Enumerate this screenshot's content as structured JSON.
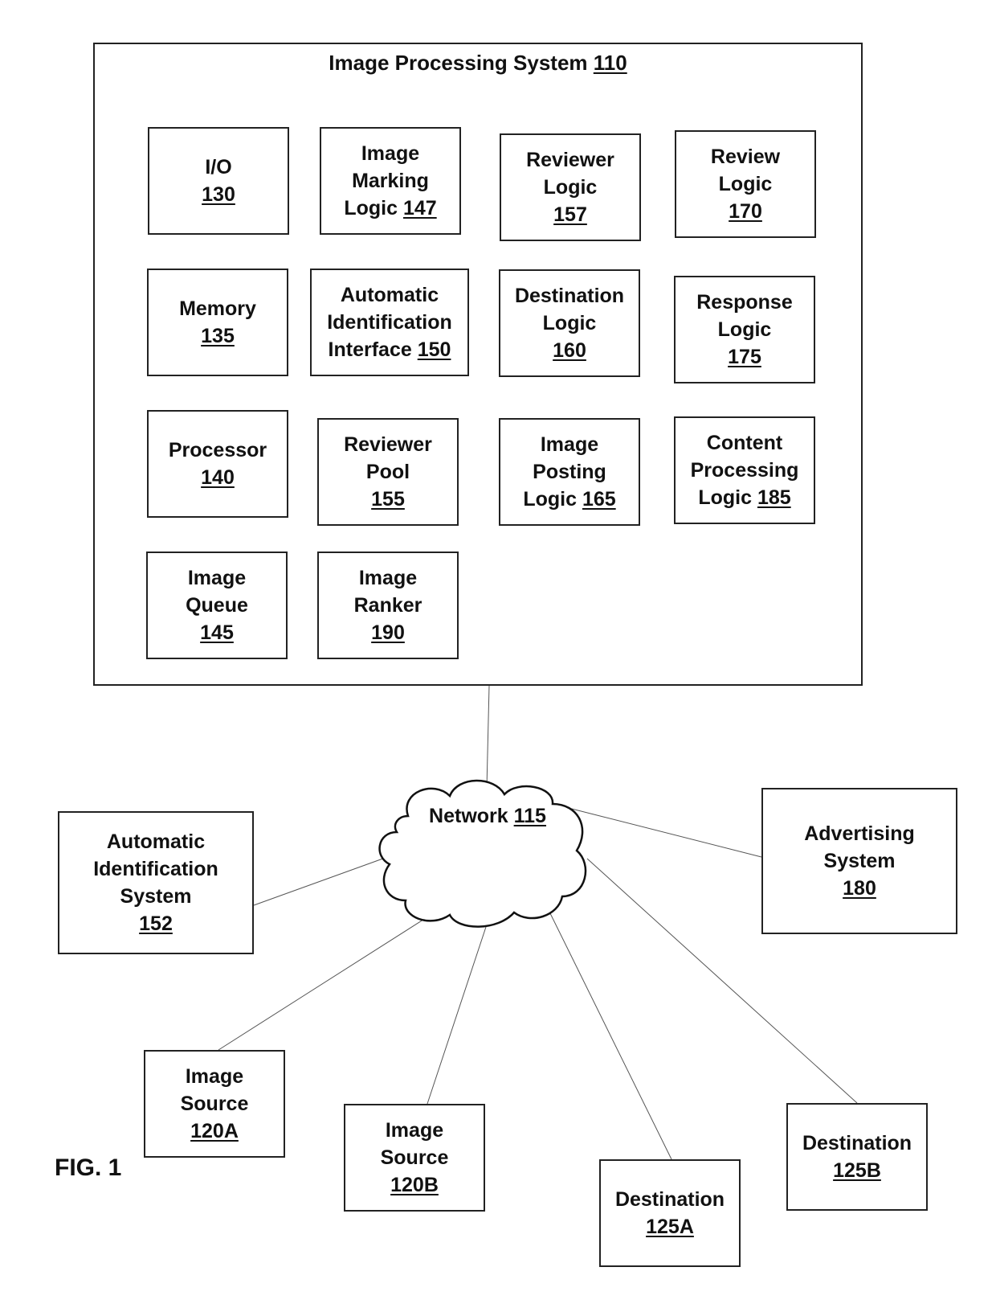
{
  "figure_label": "FIG. 1",
  "system": {
    "name": "Image Processing System",
    "ref": "110"
  },
  "components": [
    {
      "lines": [
        "I/O"
      ],
      "ref": "130",
      "ref_inline": false
    },
    {
      "lines": [
        "Image",
        "Marking",
        "Logic"
      ],
      "ref": "147",
      "ref_inline": true
    },
    {
      "lines": [
        "Reviewer",
        "Logic"
      ],
      "ref": "157",
      "ref_inline": false
    },
    {
      "lines": [
        "Review",
        "Logic"
      ],
      "ref": "170",
      "ref_inline": false
    },
    {
      "lines": [
        "Memory"
      ],
      "ref": "135",
      "ref_inline": false
    },
    {
      "lines": [
        "Automatic",
        "Identification",
        "Interface"
      ],
      "ref": "150",
      "ref_inline": true
    },
    {
      "lines": [
        "Destination",
        "Logic"
      ],
      "ref": "160",
      "ref_inline": false
    },
    {
      "lines": [
        "Response",
        "Logic"
      ],
      "ref": "175",
      "ref_inline": false
    },
    {
      "lines": [
        "Processor"
      ],
      "ref": "140",
      "ref_inline": false
    },
    {
      "lines": [
        "Reviewer",
        "Pool"
      ],
      "ref": "155",
      "ref_inline": false
    },
    {
      "lines": [
        "Image",
        "Posting",
        "Logic"
      ],
      "ref": "165",
      "ref_inline": true
    },
    {
      "lines": [
        "Content",
        "Processing",
        "Logic"
      ],
      "ref": "185",
      "ref_inline": true
    },
    {
      "lines": [
        "Image",
        "Queue"
      ],
      "ref": "145",
      "ref_inline": false
    },
    {
      "lines": [
        "Image",
        "Ranker"
      ],
      "ref": "190",
      "ref_inline": false
    }
  ],
  "network": {
    "name": "Network",
    "ref": "115"
  },
  "external": [
    {
      "id": "auto-id-system",
      "lines": [
        "Automatic",
        "Identification",
        "System"
      ],
      "ref": "152"
    },
    {
      "id": "advertising-system",
      "lines": [
        "Advertising",
        "System"
      ],
      "ref": "180"
    },
    {
      "id": "image-source-a",
      "lines": [
        "Image",
        "Source"
      ],
      "ref": "120A"
    },
    {
      "id": "image-source-b",
      "lines": [
        "Image",
        "Source"
      ],
      "ref": "120B"
    },
    {
      "id": "destination-a",
      "lines": [
        "Destination"
      ],
      "ref": "125A"
    },
    {
      "id": "destination-b",
      "lines": [
        "Destination"
      ],
      "ref": "125B"
    }
  ]
}
